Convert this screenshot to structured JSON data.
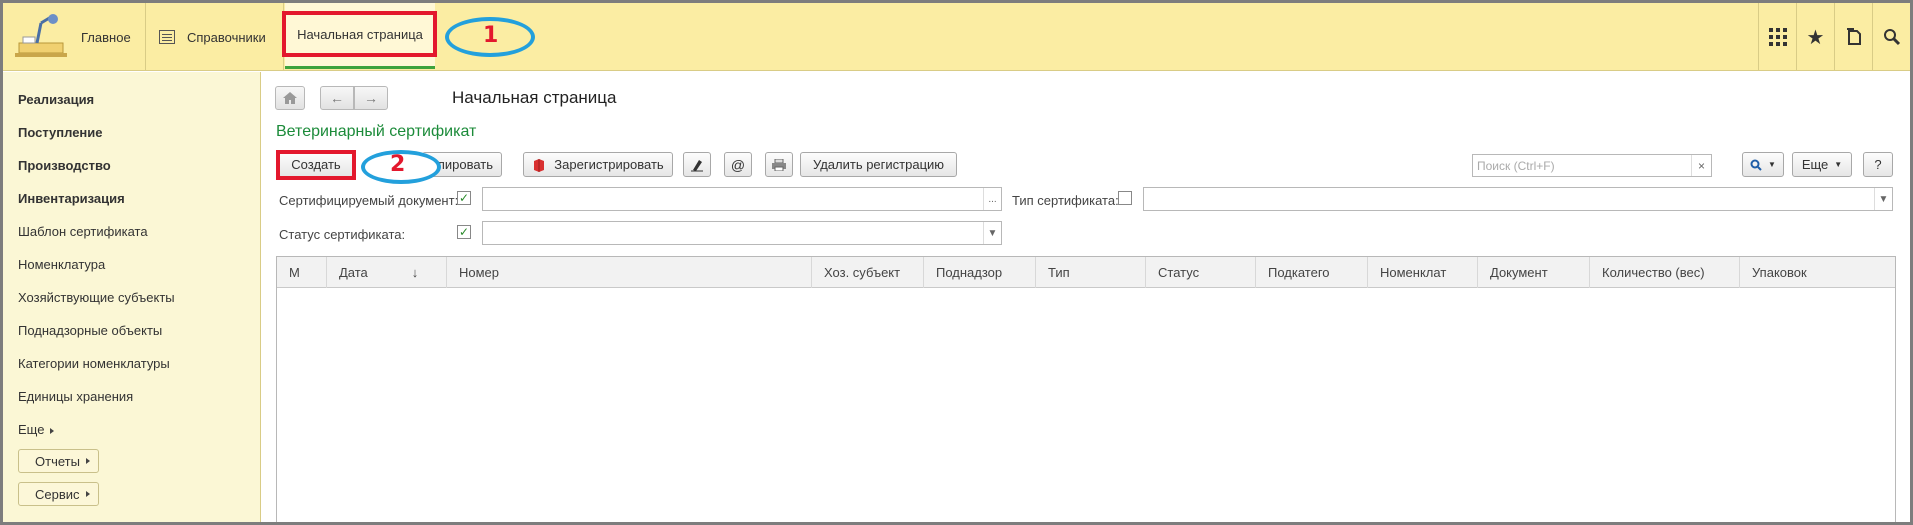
{
  "topbar": {
    "main_label": "Главное",
    "spr_label": "Справочники",
    "active_tab": "Начальная страница",
    "annotation1": "1",
    "tools": [
      "apps-icon",
      "star-icon",
      "history-icon",
      "search-icon"
    ]
  },
  "sidebar": {
    "items": [
      {
        "label": "Реализация",
        "bold": true
      },
      {
        "label": "Поступление",
        "bold": true
      },
      {
        "label": "Производство",
        "bold": true
      },
      {
        "label": "Инвентаризация",
        "bold": true
      },
      {
        "label": "Шаблон сертификата",
        "bold": false
      },
      {
        "label": "Номенклатура",
        "bold": false
      },
      {
        "label": "Хозяйствующие субъекты",
        "bold": false
      },
      {
        "label": "Поднадзорные объекты",
        "bold": false
      },
      {
        "label": "Категории номенклатуры",
        "bold": false
      },
      {
        "label": "Единицы хранения",
        "bold": false
      },
      {
        "label": "Еще",
        "bold": false
      }
    ],
    "reports_label": "Отчеты",
    "service_label": "Сервис"
  },
  "main": {
    "page_title": "Начальная страница",
    "doc_title": "Ветеринарный сертификат",
    "toolbar": {
      "create": "Создать",
      "annul": "улировать",
      "register": "Зарегистрировать",
      "at": "@",
      "delete_reg": "Удалить регистрацию",
      "search_placeholder": "Поиск (Ctrl+F)",
      "search_clear": "×",
      "more": "Еще",
      "help": "?",
      "annotation2": "2"
    },
    "filters": {
      "doc_label": "Сертифицируемый документ:",
      "doc_checked": true,
      "doc_btn": "...",
      "type_label": "Тип сертификата:",
      "type_checked": false,
      "status_label": "Статус сертификата:",
      "status_checked": true
    },
    "columns": [
      "М",
      "Дата",
      "Номер",
      "Хоз. субъект",
      "Поднадзор",
      "Тип",
      "Статус",
      "Подкатего",
      "Номенклат",
      "Документ",
      "Количество (вес)",
      "Упаковок"
    ],
    "sort_indicator": "↓"
  }
}
